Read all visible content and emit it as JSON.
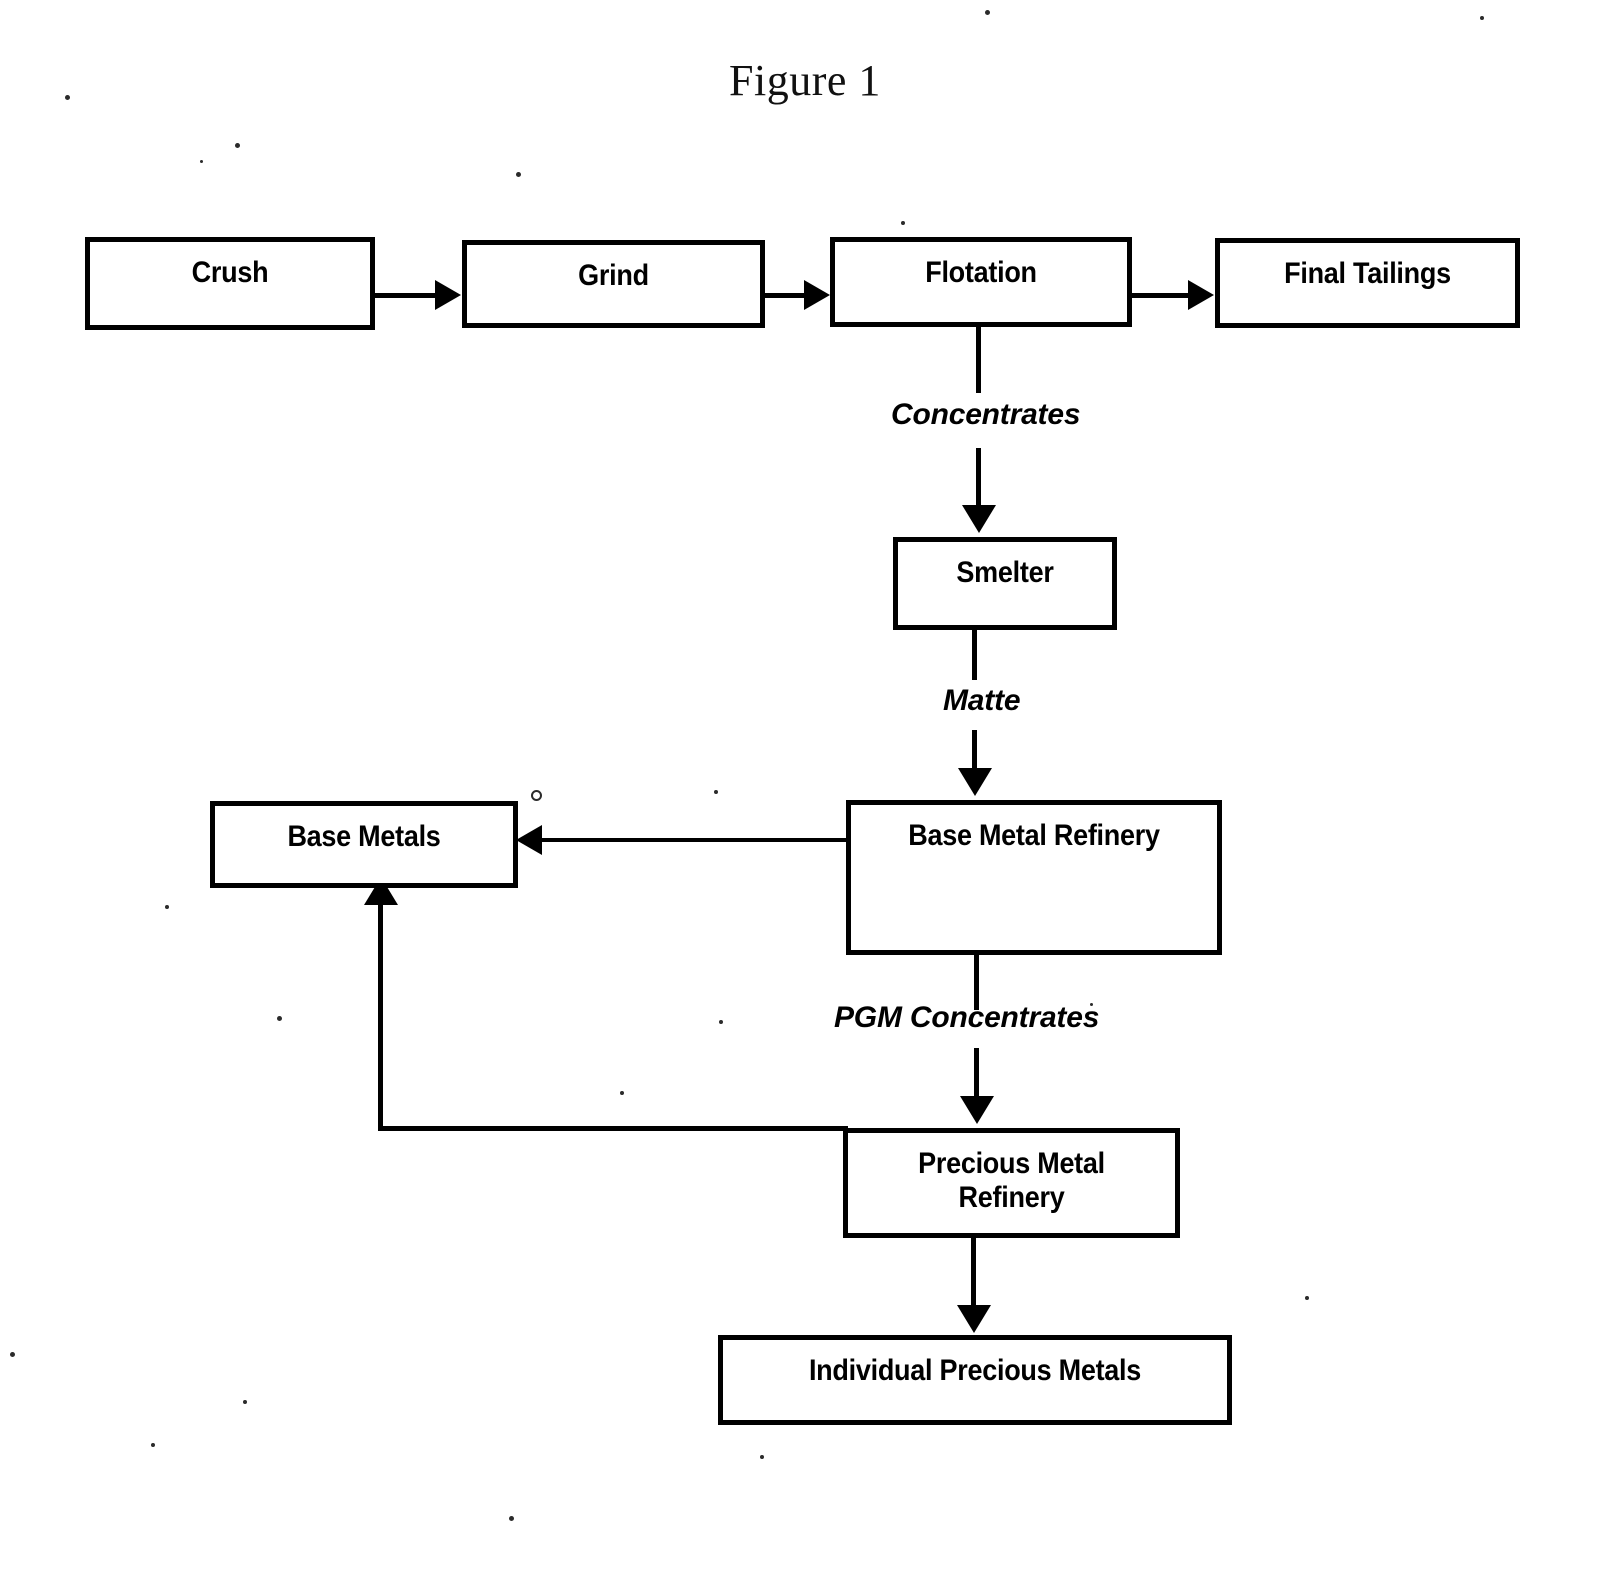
{
  "figure": {
    "title": "Figure 1"
  },
  "nodes": [
    {
      "id": "crush",
      "label": "Crush"
    },
    {
      "id": "grind",
      "label": "Grind"
    },
    {
      "id": "flotation",
      "label": "Flotation"
    },
    {
      "id": "final_tailings",
      "label": "Final Tailings"
    },
    {
      "id": "smelter",
      "label": "Smelter"
    },
    {
      "id": "base_metals",
      "label": "Base Metals"
    },
    {
      "id": "base_refinery",
      "label": "Base Metal Refinery"
    },
    {
      "id": "precious_refinery",
      "label": "Precious Metal\nRefinery"
    },
    {
      "id": "individual_pm",
      "label": "Individual Precious Metals"
    }
  ],
  "flow_labels": [
    {
      "id": "concentrates",
      "text": "Concentrates"
    },
    {
      "id": "matte",
      "text": "Matte"
    },
    {
      "id": "pgm_concentrates",
      "text": "PGM Concentrates"
    }
  ],
  "connections": [
    {
      "from": "crush",
      "to": "grind",
      "label": ""
    },
    {
      "from": "grind",
      "to": "flotation",
      "label": ""
    },
    {
      "from": "flotation",
      "to": "final_tailings",
      "label": ""
    },
    {
      "from": "flotation",
      "to": "smelter",
      "label": "Concentrates"
    },
    {
      "from": "smelter",
      "to": "base_refinery",
      "label": "Matte"
    },
    {
      "from": "base_refinery",
      "to": "base_metals",
      "label": ""
    },
    {
      "from": "base_refinery",
      "to": "precious_refinery",
      "label": "PGM Concentrates"
    },
    {
      "from": "precious_refinery",
      "to": "base_metals",
      "label": ""
    },
    {
      "from": "precious_refinery",
      "to": "individual_pm",
      "label": ""
    }
  ],
  "colors": {
    "stroke": "#000000",
    "fill": "#ffffff",
    "text": "#000000"
  }
}
